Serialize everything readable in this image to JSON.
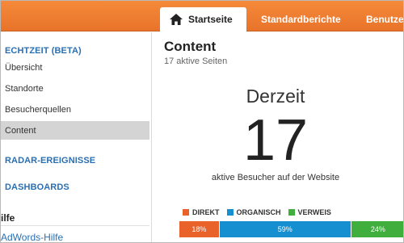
{
  "nav": {
    "tabs": [
      {
        "label": "Startseite",
        "active": true,
        "icon": "home-icon"
      },
      {
        "label": "Standardberichte",
        "active": false
      },
      {
        "label": "Benutzer",
        "active": false
      }
    ],
    "accent": "#ef7d30"
  },
  "sidebar": {
    "section_realtime": "ECHTZEIT (BETA)",
    "items": [
      {
        "label": "Übersicht"
      },
      {
        "label": "Standorte"
      },
      {
        "label": "Besucherquellen"
      },
      {
        "label": "Content",
        "selected": true
      }
    ],
    "section_radar": "RADAR-EREIGNISSE",
    "section_dashboards": "DASHBOARDS",
    "help_title": "ilfe",
    "help_link": "AdWords-Hilfe"
  },
  "main": {
    "title": "Content",
    "subtitle": "17 aktive Seiten",
    "now_label": "Derzeit",
    "active_count": "17",
    "active_caption": "aktive Besucher auf der Website"
  },
  "traffic": {
    "segments": [
      {
        "legend": "DIREKT",
        "value_label": "18%",
        "percent": 18,
        "color": "#e8622a"
      },
      {
        "legend": "ORGANISCH",
        "value_label": "59%",
        "percent": 59,
        "color": "#168fd0"
      },
      {
        "legend": "VERWEIS",
        "value_label": "24%",
        "percent": 24,
        "color": "#3fae3c"
      }
    ]
  }
}
